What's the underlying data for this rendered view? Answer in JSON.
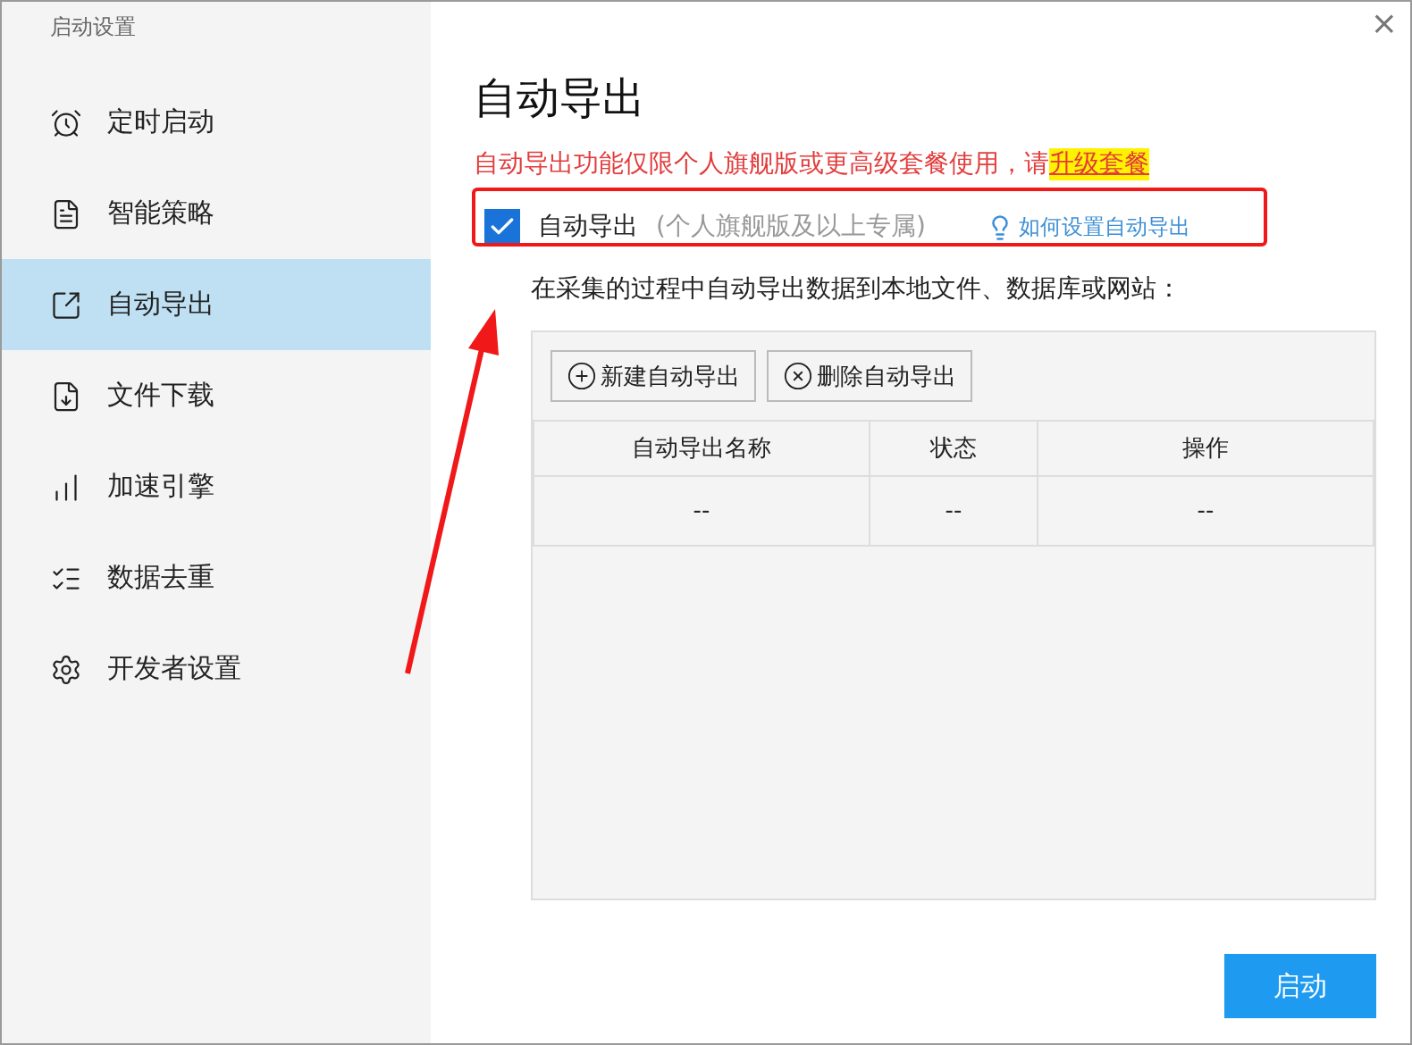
{
  "window": {
    "title": "启动设置",
    "close": "×"
  },
  "sidebar": {
    "items": [
      {
        "label": "定时启动",
        "selected": false
      },
      {
        "label": "智能策略",
        "selected": false
      },
      {
        "label": "自动导出",
        "selected": true
      },
      {
        "label": "文件下载",
        "selected": false
      },
      {
        "label": "加速引擎",
        "selected": false
      },
      {
        "label": "数据去重",
        "selected": false
      },
      {
        "label": "开发者设置",
        "selected": false
      }
    ]
  },
  "main": {
    "title": "自动导出",
    "notice": "自动导出功能仅限个人旗舰版或更高级套餐使用，请 ",
    "upgrade_link": "升级套餐",
    "option": {
      "label": "自动导出",
      "hint": "(个人旗舰版及以上专属)",
      "checked": true
    },
    "help_link": "如何设置自动导出",
    "description": "在采集的过程中自动导出数据到本地文件、数据库或网站：",
    "toolbar": [
      "新建自动导出",
      "删除自动导出"
    ],
    "table": {
      "columns": [
        "自动导出名称",
        "状态",
        "操作"
      ],
      "rows": [
        [
          "--",
          "--",
          "--"
        ]
      ]
    },
    "start_button": "启动"
  }
}
